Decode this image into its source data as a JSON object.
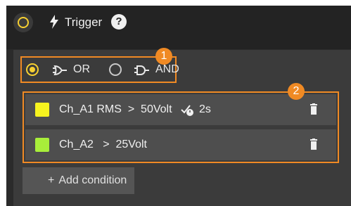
{
  "header": {
    "title": "Trigger",
    "help_label": "?"
  },
  "logic": {
    "options": [
      {
        "label": "OR",
        "selected": true
      },
      {
        "label": "AND",
        "selected": false
      }
    ]
  },
  "conditions": [
    {
      "channel_color": "#f7f31f",
      "text": "Ch_A1 RMS  >  50Volt",
      "duration": "2s",
      "duration_icon": "timer-check-icon"
    },
    {
      "channel_color": "#a8ee3a",
      "text": "Ch_A2   >  25Volt"
    }
  ],
  "add_condition": {
    "plus": "+",
    "label": "Add condition"
  },
  "callouts": [
    "1",
    "2"
  ],
  "colors": {
    "accent": "#f7d031",
    "callout": "#f08a24"
  }
}
